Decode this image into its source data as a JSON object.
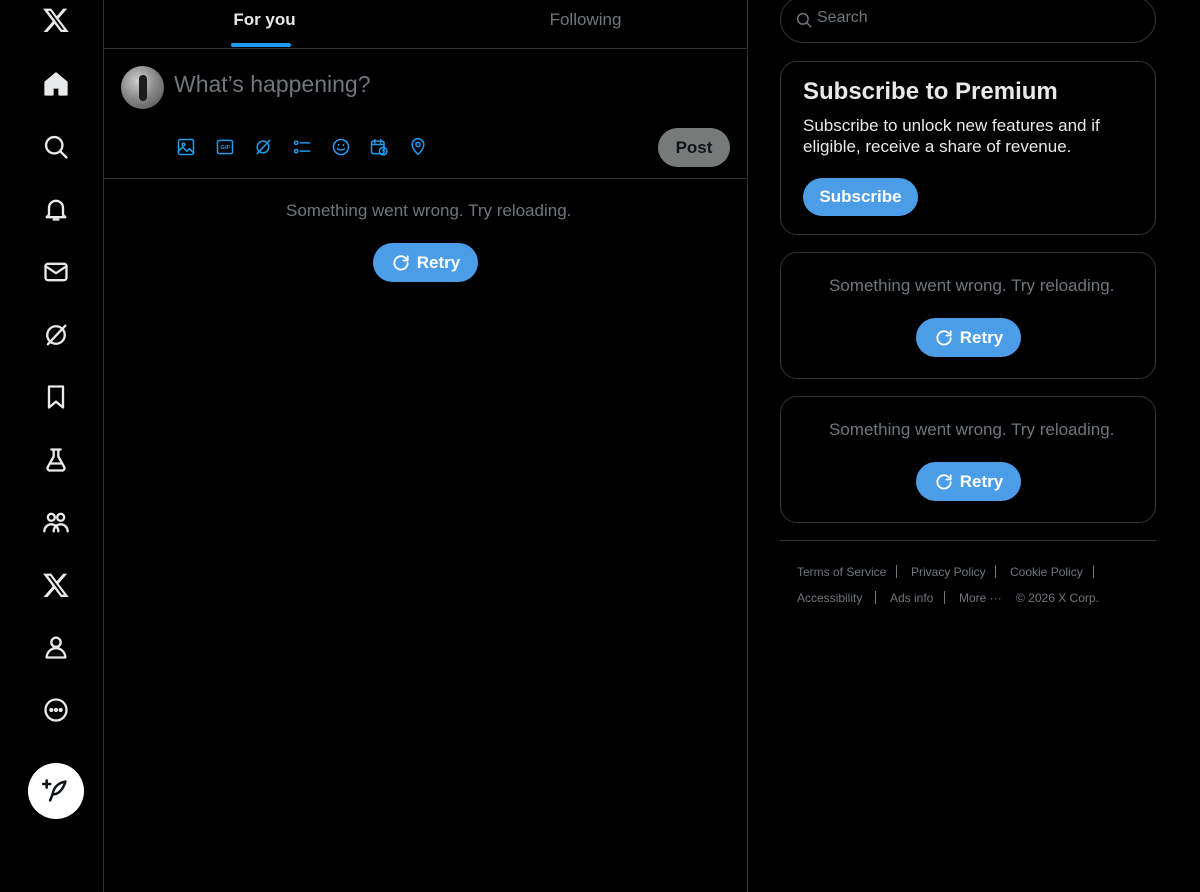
{
  "nav": {
    "items": [
      "x-logo",
      "home",
      "explore",
      "notifications",
      "messages",
      "grok",
      "bookmarks",
      "labs",
      "communities",
      "premium",
      "profile",
      "more"
    ]
  },
  "tabs": [
    {
      "label": "For you",
      "active": true
    },
    {
      "label": "Following",
      "active": false
    }
  ],
  "composer": {
    "placeholder": "What’s happening?",
    "post_label": "Post",
    "tools": [
      "media-icon",
      "gif-icon",
      "grok-icon",
      "poll-icon",
      "emoji-icon",
      "schedule-icon",
      "location-icon"
    ]
  },
  "feed": {
    "error_text": "Something went wrong. Try reloading.",
    "retry_label": "Retry"
  },
  "search": {
    "placeholder": "Search"
  },
  "premium": {
    "title": "Subscribe to Premium",
    "description": "Subscribe to unlock new features and if eligible, receive a share of revenue.",
    "button_label": "Subscribe"
  },
  "widgets": [
    {
      "error_text": "Something went wrong. Try reloading.",
      "retry_label": "Retry"
    },
    {
      "error_text": "Something went wrong. Try reloading.",
      "retry_label": "Retry"
    }
  ],
  "footer": {
    "links": [
      "Terms of Service",
      "Privacy Policy",
      "Cookie Policy",
      "Accessibility",
      "Ads info",
      "More ···"
    ],
    "copyright": "© 2026 X Corp."
  },
  "colors": {
    "background": "#000000",
    "accent": "#1d9bf0",
    "button_blue": "#4c9de8",
    "border": "#2f3336",
    "muted_text": "#71767b",
    "primary_text": "#e7e9ea"
  }
}
